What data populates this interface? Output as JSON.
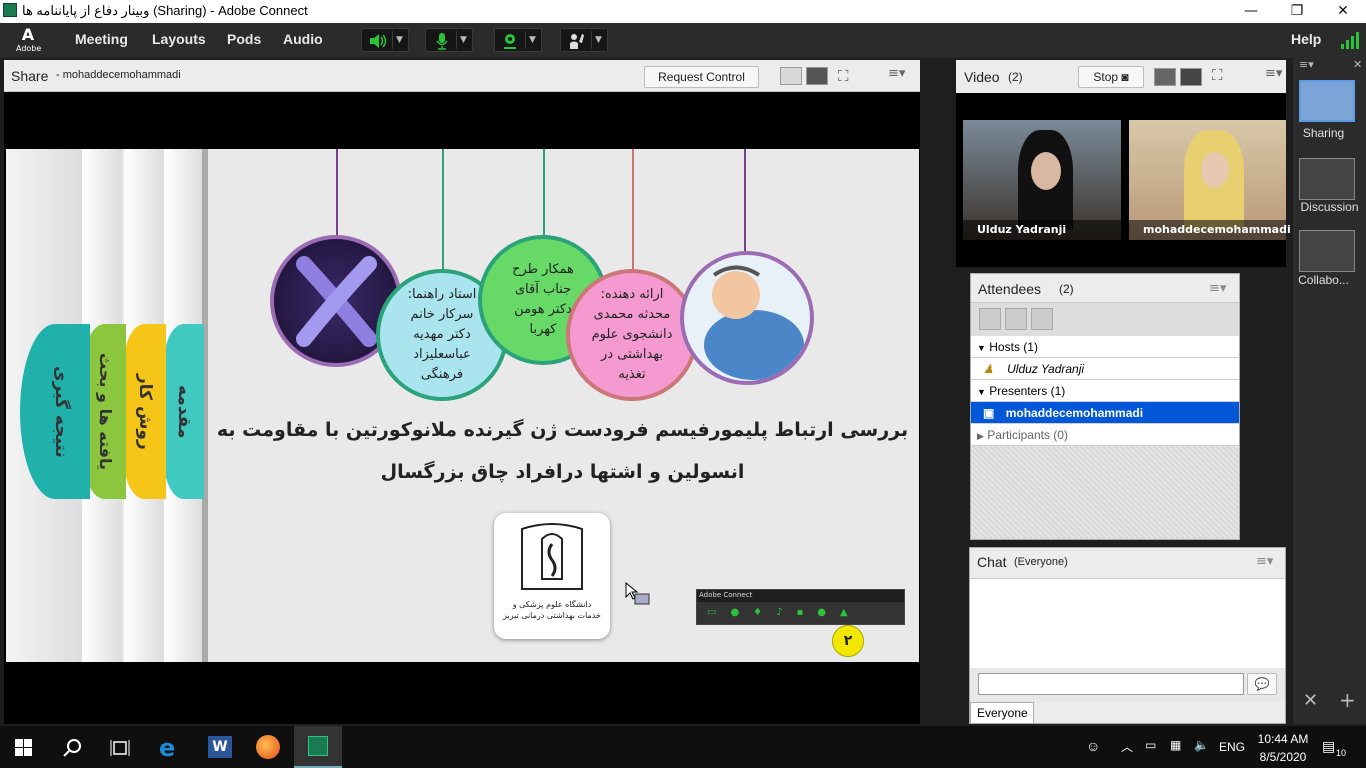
{
  "window": {
    "title": "وبینار دفاع از پایاننامه ها (Sharing) - Adobe Connect",
    "controls": {
      "minimize": "—",
      "restore": "❐",
      "close": "✕"
    }
  },
  "menubar": {
    "logo_label": "Adobe",
    "items": [
      "Meeting",
      "Layouts",
      "Pods",
      "Audio"
    ],
    "help": "Help"
  },
  "share_pod": {
    "title": "Share",
    "presenter": "- mohaddecemohammadi",
    "request_control": "Request Control"
  },
  "slide": {
    "tabs": [
      "مقدمه",
      "روش کار",
      "یافته ها و بحث",
      "نتیجه گیری"
    ],
    "tab_colors": [
      "#3fc9c0",
      "#f5c518",
      "#8cc63f",
      "#20b2aa"
    ],
    "circles": [
      {
        "text": "استاد راهنما: سرکار خانم دکتر مهدیه عباسعلیزاد فرهنگی",
        "color": "#a9e4ef",
        "line": "#2aa27a"
      },
      {
        "text": "همکار طرح جناب آقای دکتر هومن کهربا",
        "color": "#66d966",
        "line": "#2aa27a"
      },
      {
        "text": "ارائه دهنده: محدثه محمدی دانشجوی علوم بهداشتی در تغذیه",
        "color": "#f59ad0",
        "line": "#c77"
      }
    ],
    "title_line1": "بررسی ارتباط پلیمورفیسم فرودست ژن گیرنده ملانوکورتین با مقاومت به",
    "title_line2": "انسولین و اشتها درافراد چاق بزرگسال",
    "logo_caption": "دانشگاه علوم پزشکی و خدمات بهداشتی درمانی تبریز",
    "mini_bar_title": "Adobe Connect",
    "page_number": "۲"
  },
  "video_pod": {
    "title": "Video",
    "count": "(2)",
    "stop_label": "Stop",
    "participants": [
      "Ulduz Yadranji",
      "mohaddecemohammadi"
    ]
  },
  "attendees_pod": {
    "title": "Attendees",
    "count": "(2)",
    "groups": [
      {
        "label": "Hosts (1)",
        "members": [
          "Ulduz Yadranji"
        ]
      },
      {
        "label": "Presenters (1)",
        "members": [
          "mohaddecemohammadi"
        ]
      },
      {
        "label": "Participants (0)",
        "members": []
      }
    ]
  },
  "chat_pod": {
    "title": "Chat",
    "scope": "(Everyone)",
    "input_value": "",
    "tab": "Everyone"
  },
  "layouts": [
    "Sharing",
    "Discussion",
    "Collabo..."
  ],
  "taskbar": {
    "language": "ENG",
    "time": "10:44 AM",
    "date": "8/5/2020",
    "notification_count": "10"
  },
  "colors": {
    "accent": "#0057d8",
    "menubar": "#2b2b2b",
    "green": "#29c43a"
  }
}
